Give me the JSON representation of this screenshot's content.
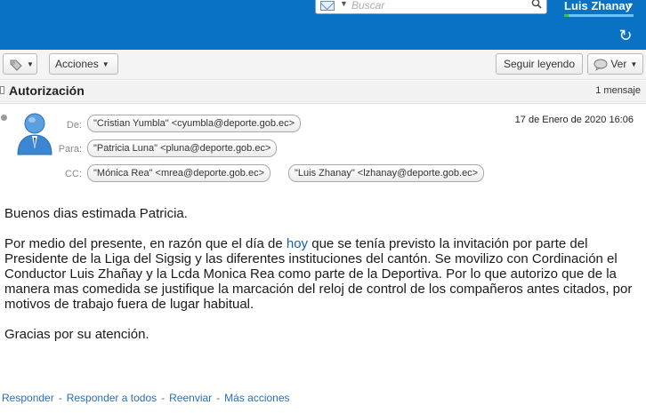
{
  "topbar": {
    "search_placeholder": "Buscar",
    "user_name": "Luis Zhanay",
    "dropdown_glyph": "▼",
    "refresh_glyph": "↻",
    "colors": {
      "bar": "#0a72c4"
    }
  },
  "toolbar": {
    "tag_icon": "tag-icon",
    "actions_label": "Acciones",
    "unread_label": "Seguir leyendo",
    "view_label": "Ver",
    "dropdown_glyph": "▼"
  },
  "conversation": {
    "title": "Autorización",
    "count": "1 mensaje"
  },
  "message": {
    "from_label": "De:",
    "to_label": "Para:",
    "cc_label": "CC:",
    "from": "\"Cristian Yumbla\" <cyumbla@deporte.gob.ec>",
    "to": "\"Patricia Luna\" <pluna@deporte.gob.ec>",
    "cc": [
      "\"Mónica Rea\" <mrea@deporte.gob.ec>",
      "\"Luis Zhanay\" <lzhanay@deporte.gob.ec>"
    ],
    "date": "17 de Enero de 2020 16:06",
    "body": {
      "greeting": "Buenos dias estimada Patricia.",
      "para_before": "Por medio del presente, en razón que el día de ",
      "para_highlight": "hoy",
      "para_after": " que se tenía previsto la invitación por parte del Presidente de la Liga del Sigsig y las diferentes instituciones del cantón. Se movilizo con Cordinación el Conductor Luis Zhañay y la Lcda Monica Rea como parte de la Deportiva. Por lo que autorizo que de la manera mas comedida se justifique la marcación del reloj de control de los compañeros antes citados, por motivos de trabajo fuera de lugar habitual.",
      "closing": "Gracias por su atención."
    }
  },
  "footer": {
    "reply": "Responder",
    "reply_all": "Responder a todos",
    "forward": "Reenviar",
    "more": "Más acciones",
    "separator": "-"
  }
}
